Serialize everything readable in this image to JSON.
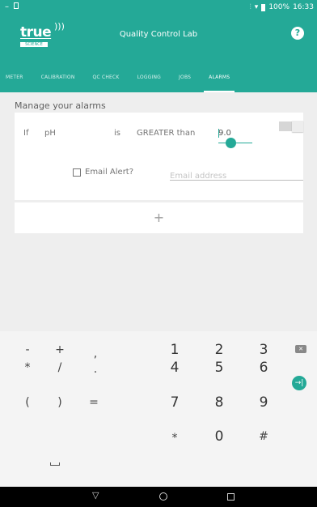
{
  "status_bar": {
    "left_icons": "–",
    "battery": "100%",
    "time": "16:33"
  },
  "app_bar": {
    "logo_text": "true",
    "logo_tagline": "SCIENCE",
    "title": "Quality Control Lab",
    "help_icon": "?"
  },
  "tabs": [
    {
      "label": "METER",
      "active": false
    },
    {
      "label": "CALIBRATION",
      "active": false
    },
    {
      "label": "QC CHECK",
      "active": false
    },
    {
      "label": "LOGGING",
      "active": false
    },
    {
      "label": "JOBS",
      "active": false
    },
    {
      "label": "ALARMS",
      "active": true
    }
  ],
  "section": {
    "title": "Manage your alarms"
  },
  "alarm": {
    "if_label": "If",
    "parameter": "pH",
    "is_label": "is",
    "condition": "GREATER than",
    "value": "9.0",
    "enabled": false
  },
  "email": {
    "checkbox_label": "Email Alert?",
    "checked": false,
    "placeholder": "Email address",
    "value": ""
  },
  "add_button": {
    "label": "+"
  },
  "keyboard": {
    "rows": [
      [
        "-",
        "+",
        ",",
        "1",
        "2",
        "3",
        "⌫"
      ],
      [
        "*",
        "/",
        ".",
        "4",
        "5",
        "6",
        "→|"
      ],
      [
        "(",
        ")",
        "=",
        "7",
        "8",
        "9",
        ""
      ],
      [
        "␣",
        "",
        "",
        "*",
        "0",
        "#",
        ""
      ]
    ]
  },
  "colors": {
    "accent": "#24a997",
    "background": "#eeeeee",
    "card": "#ffffff"
  },
  "icons": {
    "help": "help-icon",
    "backspace": "backspace-icon",
    "go": "go-icon",
    "back": "back-icon",
    "home": "home-icon",
    "recents": "recents-icon"
  }
}
